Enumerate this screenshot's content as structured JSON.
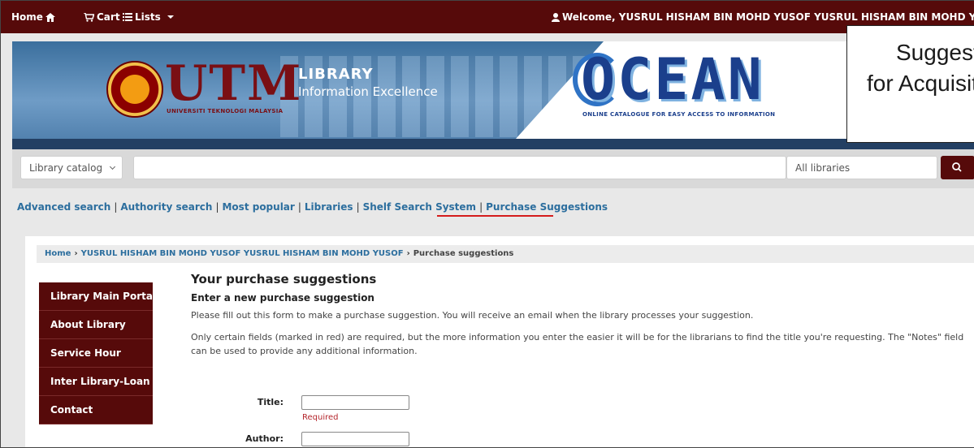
{
  "topbar": {
    "home_label": "Home",
    "cart_label": "Cart",
    "lists_label": "Lists",
    "welcome_text": "Welcome, YUSRUL HISHAM BIN MOHD YUSOF YUSRUL HISHAM BIN MOHD YUSOF"
  },
  "banner": {
    "utm_logo": "UTM",
    "utm_subtitle": "UNIVERSITI TEKNOLOGI MALAYSIA",
    "library_title": "LIBRARY",
    "library_tagline": "Information Excellence",
    "ocean_logo": "OCEAN",
    "ocean_subtitle": "ONLINE CATALOGUE FOR EASY ACCESS TO INFORMATION"
  },
  "search": {
    "catalog_select": "Library catalog",
    "library_select": "All libraries",
    "query": ""
  },
  "navlinks": {
    "advanced": "Advanced search",
    "authority": "Authority search",
    "popular": "Most popular",
    "libraries": "Libraries",
    "shelf": "Shelf Search System",
    "purchase": "Purchase Suggestions",
    "separator": "|"
  },
  "breadcrumb": {
    "home": "Home",
    "user": "YUSRUL HISHAM BIN MOHD YUSOF YUSRUL HISHAM BIN MOHD YUSOF",
    "current": "Purchase suggestions",
    "arrow": "›"
  },
  "sidemenu": {
    "items": [
      {
        "label": "Library Main Portal"
      },
      {
        "label": "About Library"
      },
      {
        "label": "Service Hour"
      },
      {
        "label": "Inter Library-Loan"
      },
      {
        "label": "Contact"
      }
    ]
  },
  "content": {
    "heading": "Your purchase suggestions",
    "subheading": "Enter a new purchase suggestion",
    "para1": "Please fill out this form to make a purchase suggestion. You will receive an email when the library processes your suggestion.",
    "para2": "Only certain fields (marked in red) are required, but the more information you enter the easier it will be for the librarians to find the title you're requesting. The \"Notes\" field can be used to provide any additional information."
  },
  "form": {
    "title_label": "Title:",
    "title_value": "",
    "required_text": "Required",
    "author_label": "Author:",
    "author_value": ""
  },
  "callout": {
    "line1": "Suggestion",
    "line2": "for Acquisition"
  },
  "colors": {
    "maroon": "#560a0a",
    "link_blue": "#2c6e9e",
    "required_red": "#b4262c"
  }
}
